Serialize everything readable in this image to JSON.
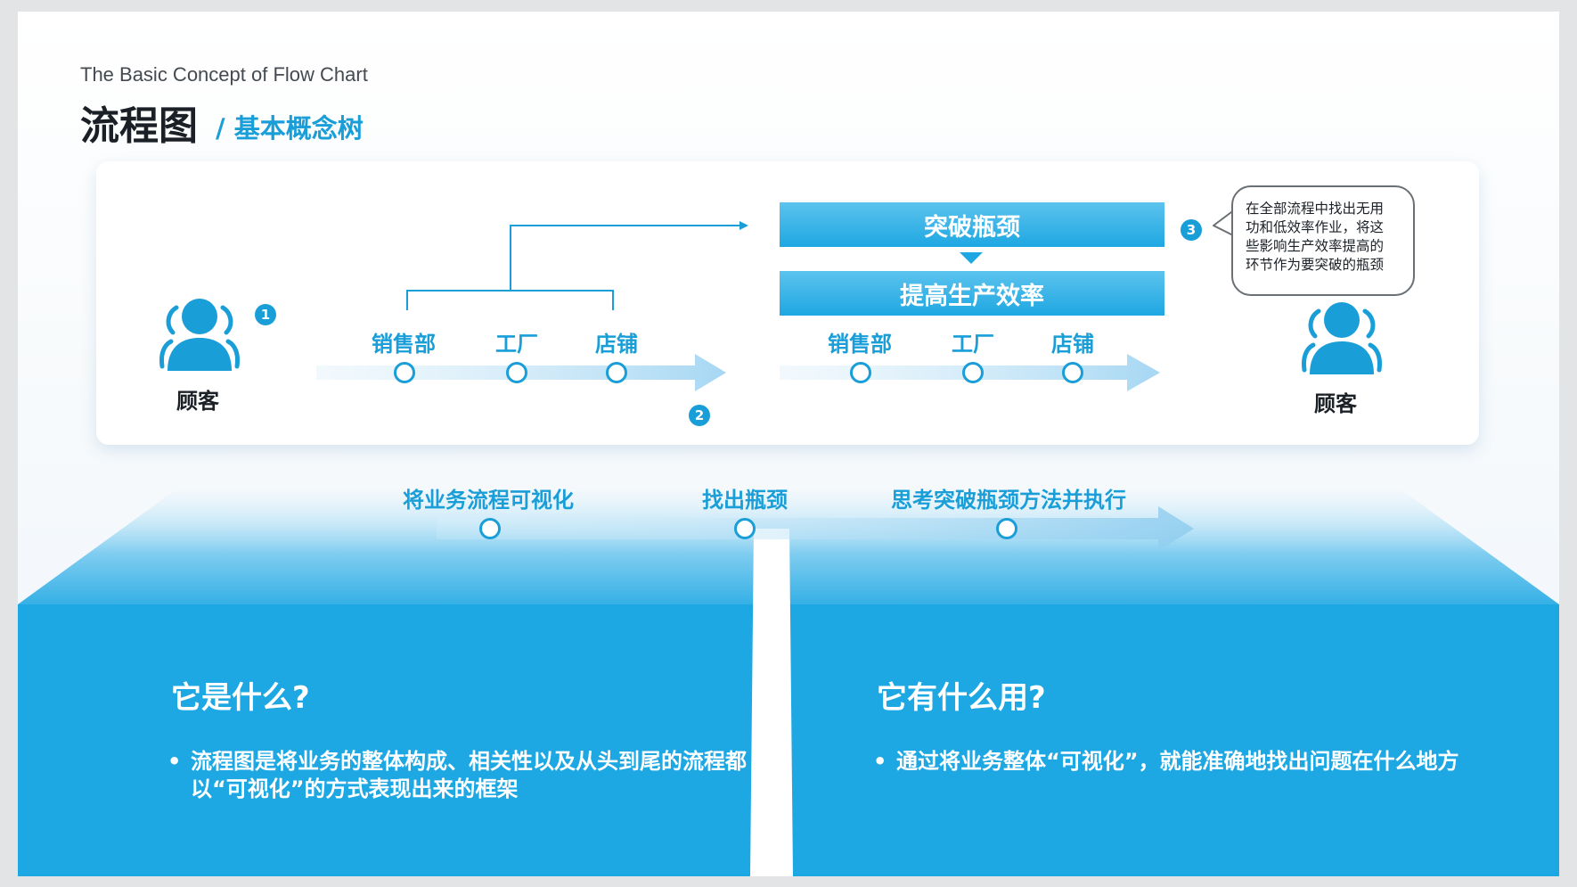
{
  "header": {
    "subtitle_en": "The Basic Concept of Flow Chart",
    "title": "流程图",
    "separator": "/",
    "title_sub": "基本概念树"
  },
  "diagram": {
    "customer_left": "顾客",
    "customer_right": "顾客",
    "badges": [
      "1",
      "2",
      "3"
    ],
    "flow_labels_1": [
      "销售部",
      "工厂",
      "店铺"
    ],
    "flow_labels_2": [
      "销售部",
      "工厂",
      "店铺"
    ],
    "box_top": "突破瓶颈",
    "box_bottom": "提高生产效率",
    "callout_lines": [
      "在全部流程中找出无用",
      "功和低效率作业，将这",
      "些影响生产效率提高的",
      "环节作为要突破的瓶颈"
    ]
  },
  "timeline": {
    "steps": [
      "将业务流程可视化",
      "找出瓶颈",
      "思考突破瓶颈方法并执行"
    ]
  },
  "panels": {
    "left": {
      "title": "它是什么?",
      "bullet": "流程图是将业务的整体构成、相关性以及从头到尾的流程都以“可视化”的方式表现出来的框架"
    },
    "right": {
      "title": "它有什么用?",
      "bullet": "通过将业务整体“可视化”，就能准确地找出问题在什么地方"
    }
  },
  "colors": {
    "accent": "#1a9ed8",
    "panel": "#1ea8e3",
    "title": "#1b2026"
  }
}
